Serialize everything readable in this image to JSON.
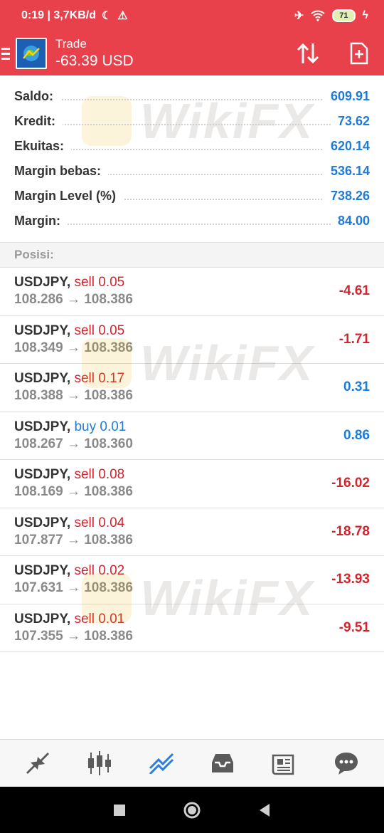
{
  "status": {
    "time_speed": "0:19 | 3,7KB/d",
    "battery": "71"
  },
  "appbar": {
    "title": "Trade",
    "profit": "-63.39 USD"
  },
  "summary": [
    {
      "label": "Saldo:",
      "value": "609.91"
    },
    {
      "label": "Kredit:",
      "value": "73.62"
    },
    {
      "label": "Ekuitas:",
      "value": "620.14"
    },
    {
      "label": "Margin bebas:",
      "value": "536.14"
    },
    {
      "label": "Margin Level (%)",
      "value": "738.26"
    },
    {
      "label": "Margin:",
      "value": "84.00"
    }
  ],
  "positions_header": "Posisi:",
  "positions": [
    {
      "symbol": "USDJPY,",
      "side": "sell 0.05",
      "type": "sell",
      "prices": "108.286 → 108.386",
      "pnl": "-4.61",
      "negative": true
    },
    {
      "symbol": "USDJPY,",
      "side": "sell 0.05",
      "type": "sell",
      "prices": "108.349 → 108.386",
      "pnl": "-1.71",
      "negative": true
    },
    {
      "symbol": "USDJPY,",
      "side": "sell 0.17",
      "type": "sell",
      "prices": "108.388 → 108.386",
      "pnl": "0.31",
      "negative": false
    },
    {
      "symbol": "USDJPY,",
      "side": "buy 0.01",
      "type": "buy",
      "prices": "108.267 → 108.360",
      "pnl": "0.86",
      "negative": false
    },
    {
      "symbol": "USDJPY,",
      "side": "sell 0.08",
      "type": "sell",
      "prices": "108.169 → 108.386",
      "pnl": "-16.02",
      "negative": true
    },
    {
      "symbol": "USDJPY,",
      "side": "sell 0.04",
      "type": "sell",
      "prices": "107.877 → 108.386",
      "pnl": "-18.78",
      "negative": true
    },
    {
      "symbol": "USDJPY,",
      "side": "sell 0.02",
      "type": "sell",
      "prices": "107.631 → 108.386",
      "pnl": "-13.93",
      "negative": true
    },
    {
      "symbol": "USDJPY,",
      "side": "sell 0.01",
      "type": "sell",
      "prices": "107.355 → 108.386",
      "pnl": "-9.51",
      "negative": true
    }
  ],
  "watermark": "WikiFX",
  "bottom_nav": [
    {
      "icon": "quotes-icon",
      "active": false
    },
    {
      "icon": "chart-icon",
      "active": false
    },
    {
      "icon": "trade-icon",
      "active": true
    },
    {
      "icon": "history-icon",
      "active": false
    },
    {
      "icon": "news-icon",
      "active": false
    },
    {
      "icon": "chat-icon",
      "active": false
    }
  ],
  "colors": {
    "appbar": "#e8414b",
    "blue": "#1f7bd6",
    "red": "#d0262f"
  }
}
